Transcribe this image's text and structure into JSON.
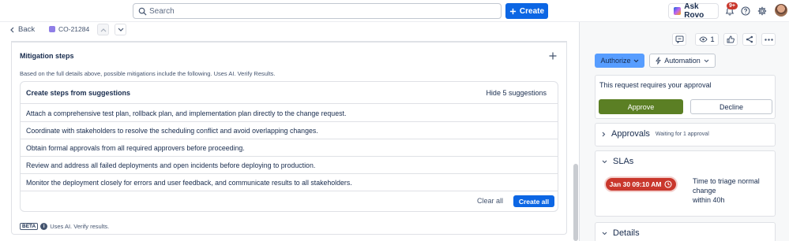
{
  "topbar": {
    "search_placeholder": "Search",
    "create_label": "Create",
    "rovo_label": "Ask Rovo",
    "notifications_badge": "9+"
  },
  "subheader": {
    "back_label": "Back",
    "issue_key": "CO-21284"
  },
  "mitigation": {
    "title": "Mitigation steps",
    "description": "Based on the full details above, possible mitigations include the following. Uses AI. Verify Results.",
    "box_title": "Create steps from suggestions",
    "hide_label": "Hide 5 suggestions",
    "suggestions": [
      "Attach a comprehensive test plan, rollback plan, and implementation plan directly to the change request.",
      "Coordinate with stakeholders to resolve the scheduling conflict and avoid overlapping changes.",
      "Obtain formal approvals from all required approvers before proceeding.",
      "Review and address all failed deployments and open incidents before deploying to production.",
      "Monitor the deployment closely for errors and user feedback, and communicate results to all stakeholders."
    ],
    "clear_all_label": "Clear all",
    "create_all_label": "Create all",
    "beta_label": "BETA",
    "beta_note": "Uses AI. Verify results."
  },
  "right": {
    "watch_count": "1",
    "authorize_label": "Authorize",
    "automation_label": "Automation",
    "approval_text": "This request requires your approval",
    "approve_label": "Approve",
    "decline_label": "Decline",
    "approvals_title": "Approvals",
    "approvals_status": "Waiting for 1 approval",
    "slas_title": "SLAs",
    "sla_time": "Jan 30 09:10 AM",
    "sla_desc_1": "Time to triage normal change",
    "sla_desc_2": "within 40h",
    "details_title": "Details"
  },
  "colors": {
    "primary": "#0c66e4",
    "approve": "#5b7f24",
    "sla_breach": "#c9372c"
  }
}
